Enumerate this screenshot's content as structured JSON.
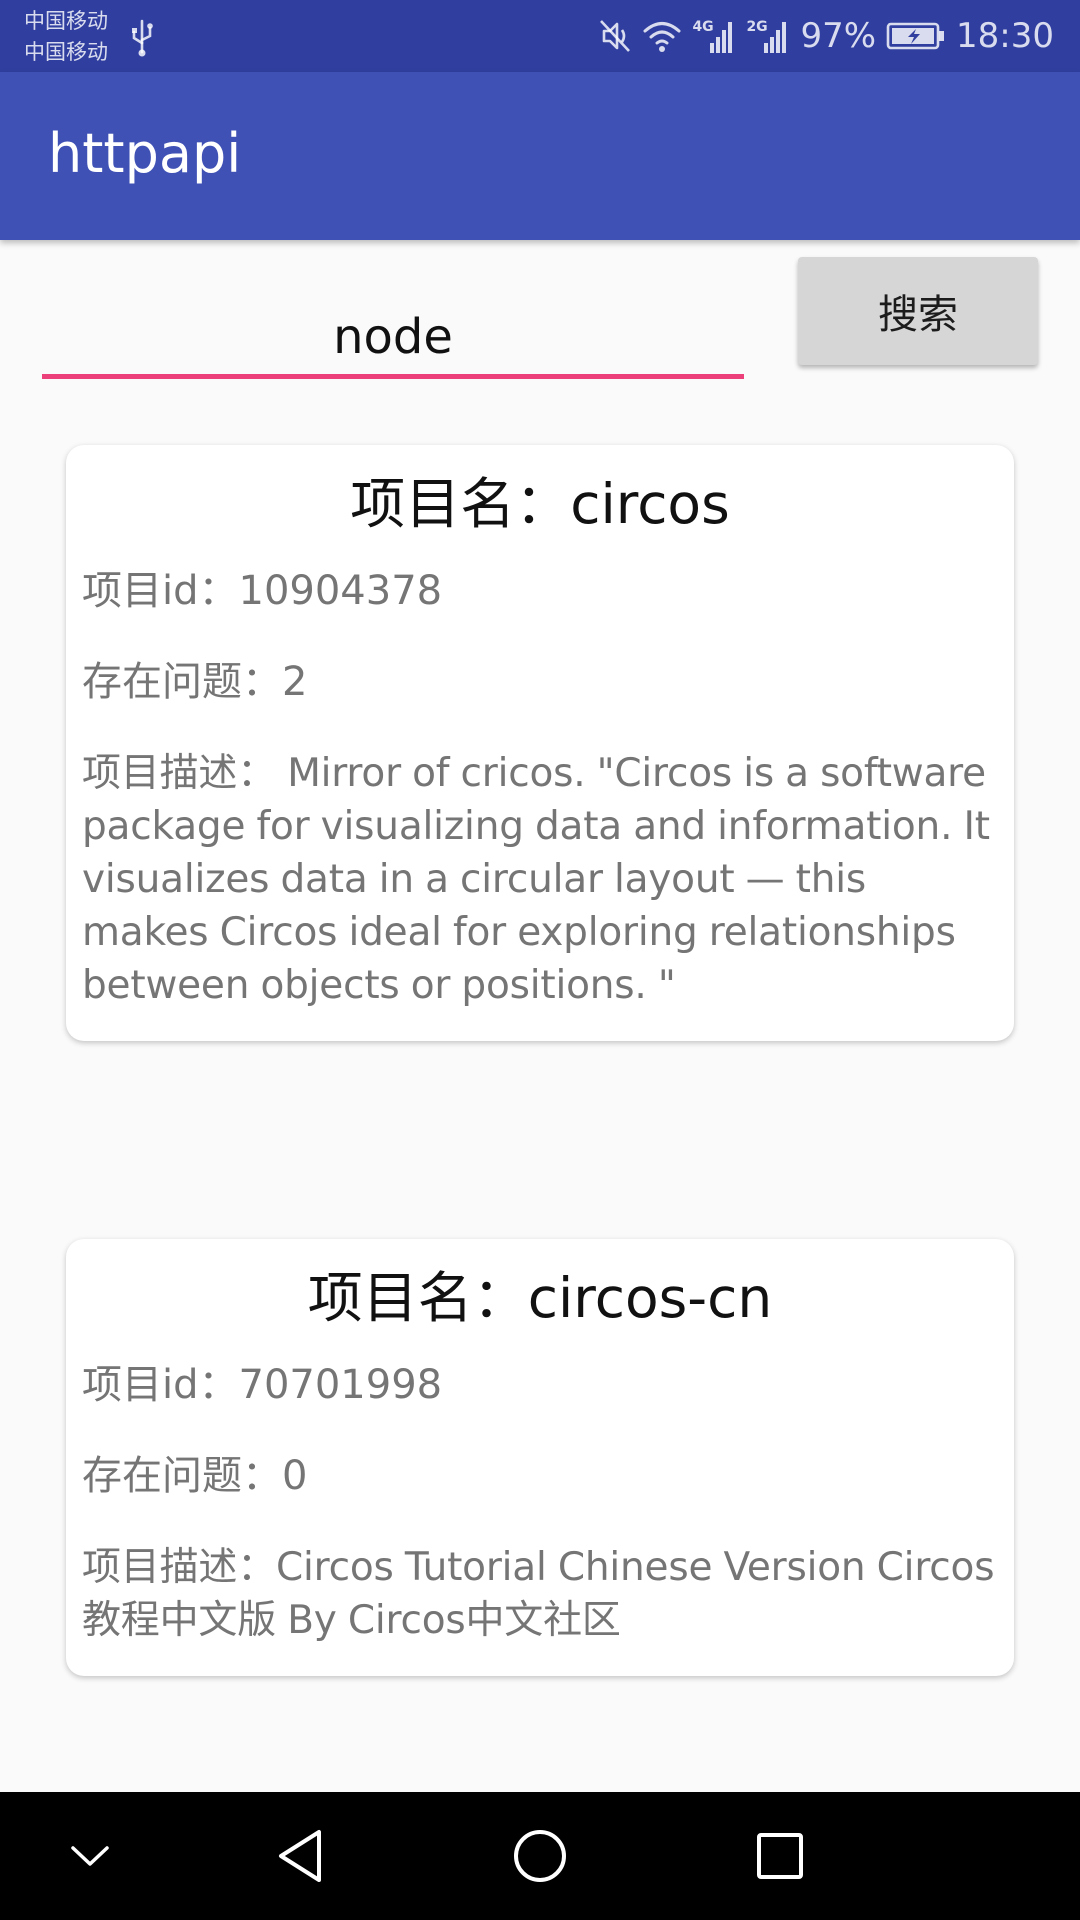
{
  "status_bar": {
    "carrier_1": "中国移动",
    "carrier_2": "中国移动",
    "network_1": "4G",
    "network_2": "2G",
    "battery_percent": "97%",
    "time": "18:30",
    "icons": [
      "usb-icon",
      "mute-icon",
      "wifi-icon",
      "signal-icon",
      "signal-icon",
      "battery-charging-icon"
    ]
  },
  "app_bar": {
    "title": "httpapi"
  },
  "search": {
    "query": "node",
    "button_label": "搜索"
  },
  "results": [
    {
      "name_line": "项目名：circos",
      "id_line": "项目id：10904378",
      "issues_line": "存在问题：2",
      "description_line": "项目描述： Mirror of cricos.  \"Circos is a software package for visualizing data and information. It visualizes data in a circular layout — this makes Circos ideal for exploring relationships between objects or positions. \""
    },
    {
      "name_line": "项目名：circos-cn",
      "id_line": "项目id：70701998",
      "issues_line": "存在问题：0",
      "description_line": "项目描述：Circos  Tutorial Chinese Version Circos教程中文版 By Circos中文社区"
    }
  ],
  "nav_bar": {
    "icons": [
      "hide-keyboard-icon",
      "back-icon",
      "home-icon",
      "recents-icon"
    ]
  }
}
